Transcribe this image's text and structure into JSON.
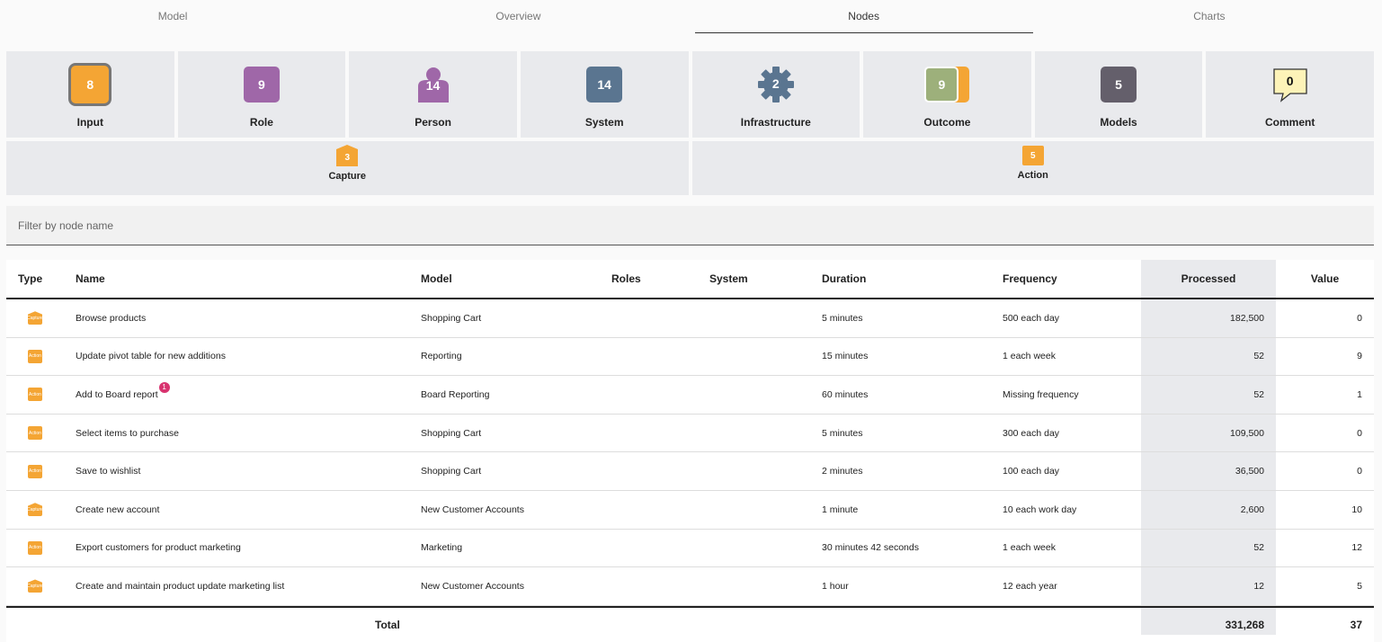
{
  "tabs": [
    {
      "label": "Model",
      "active": false
    },
    {
      "label": "Overview",
      "active": false
    },
    {
      "label": "Nodes",
      "active": true
    },
    {
      "label": "Charts",
      "active": false
    }
  ],
  "node_cards": [
    {
      "label": "Input",
      "count": "8",
      "icon": "input-icon",
      "color": "#f4a534"
    },
    {
      "label": "Role",
      "count": "9",
      "icon": "role-icon",
      "color": "#9f67a8"
    },
    {
      "label": "Person",
      "count": "14",
      "icon": "person-icon",
      "color": "#9f67a8"
    },
    {
      "label": "System",
      "count": "14",
      "icon": "system-icon",
      "color": "#5a7590"
    },
    {
      "label": "Infrastructure",
      "count": "2",
      "icon": "gear-icon",
      "color": "#5a7590"
    },
    {
      "label": "Outcome",
      "count": "9",
      "icon": "outcome-icon",
      "color": "#9db07b"
    },
    {
      "label": "Models",
      "count": "5",
      "icon": "models-icon",
      "color": "#645f6b"
    },
    {
      "label": "Comment",
      "count": "0",
      "icon": "comment-icon",
      "color": "#fdf3b8"
    }
  ],
  "sub_cards": [
    {
      "label": "Capture",
      "count": "3",
      "icon": "capture-icon"
    },
    {
      "label": "Action",
      "count": "5",
      "icon": "action-icon"
    }
  ],
  "filter": {
    "placeholder": "Filter by node name",
    "value": ""
  },
  "table": {
    "headers": {
      "type": "Type",
      "name": "Name",
      "model": "Model",
      "roles": "Roles",
      "system": "System",
      "duration": "Duration",
      "frequency": "Frequency",
      "processed": "Processed",
      "value": "Value"
    },
    "type_icon_text": {
      "capture": "Capture",
      "action": "Action"
    },
    "rows": [
      {
        "type": "capture",
        "name": "Browse products",
        "badge": "",
        "model": "Shopping Cart",
        "roles": "",
        "system": "",
        "duration": "5 minutes",
        "frequency": "500 each day",
        "processed": "182,500",
        "value": "0"
      },
      {
        "type": "action",
        "name": "Update pivot table for new additions",
        "badge": "",
        "model": "Reporting",
        "roles": "",
        "system": "",
        "duration": "15 minutes",
        "frequency": "1 each week",
        "processed": "52",
        "value": "9"
      },
      {
        "type": "action",
        "name": "Add to Board report",
        "badge": "1",
        "model": "Board Reporting",
        "roles": "",
        "system": "",
        "duration": "60 minutes",
        "frequency": "Missing frequency",
        "processed": "52",
        "value": "1"
      },
      {
        "type": "action",
        "name": "Select items to purchase",
        "badge": "",
        "model": "Shopping Cart",
        "roles": "",
        "system": "",
        "duration": "5 minutes",
        "frequency": "300 each day",
        "processed": "109,500",
        "value": "0"
      },
      {
        "type": "action",
        "name": "Save to wishlist",
        "badge": "",
        "model": "Shopping Cart",
        "roles": "",
        "system": "",
        "duration": "2 minutes",
        "frequency": "100 each day",
        "processed": "36,500",
        "value": "0"
      },
      {
        "type": "capture",
        "name": "Create new account",
        "badge": "",
        "model": "New Customer Accounts",
        "roles": "",
        "system": "",
        "duration": "1 minute",
        "frequency": "10 each work day",
        "processed": "2,600",
        "value": "10"
      },
      {
        "type": "action",
        "name": "Export customers for product marketing",
        "badge": "",
        "model": "Marketing",
        "roles": "",
        "system": "",
        "duration": "30 minutes 42 seconds",
        "frequency": "1 each week",
        "processed": "52",
        "value": "12"
      },
      {
        "type": "capture",
        "name": "Create and maintain product update marketing list",
        "badge": "",
        "model": "New Customer Accounts",
        "roles": "",
        "system": "",
        "duration": "1 hour",
        "frequency": "12 each year",
        "processed": "12",
        "value": "5"
      }
    ],
    "total": {
      "label": "Total",
      "processed": "331,268",
      "value": "37"
    }
  }
}
